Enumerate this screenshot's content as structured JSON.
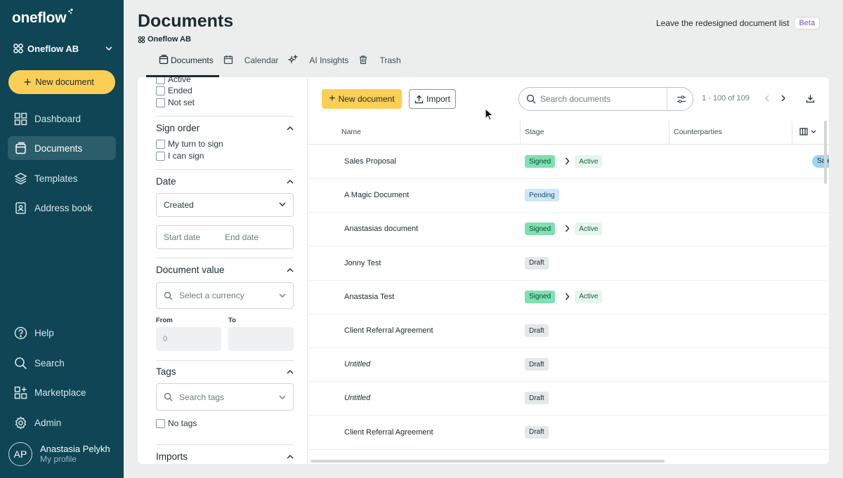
{
  "sidebar": {
    "logo": "oneflow",
    "workspace": "Oneflow AB",
    "new_document": "New document",
    "nav": [
      {
        "label": "Dashboard",
        "icon": "dashboard-icon"
      },
      {
        "label": "Documents",
        "icon": "documents-icon",
        "active": true
      },
      {
        "label": "Templates",
        "icon": "templates-icon"
      },
      {
        "label": "Address book",
        "icon": "address-book-icon"
      }
    ],
    "bottom_nav": [
      {
        "label": "Help",
        "icon": "help-icon"
      },
      {
        "label": "Search",
        "icon": "search-icon"
      },
      {
        "label": "Marketplace",
        "icon": "marketplace-icon"
      },
      {
        "label": "Admin",
        "icon": "gear-icon"
      }
    ],
    "profile": {
      "initials": "AP",
      "name": "Anastasia Pelykh",
      "subtitle": "My profile"
    }
  },
  "header": {
    "title": "Documents",
    "org": "Oneflow AB",
    "leave_redesign": "Leave the redesigned document list",
    "beta": "Beta",
    "tabs": [
      {
        "label": "Documents",
        "icon": "document-icon",
        "active": true
      },
      {
        "label": "Calendar",
        "icon": "calendar-icon"
      },
      {
        "label": "AI Insights",
        "icon": "sparkle-icon"
      },
      {
        "label": "Trash",
        "icon": "trash-icon"
      }
    ]
  },
  "filters": {
    "status_options": [
      "Active",
      "Ended",
      "Not set"
    ],
    "sign_order": {
      "title": "Sign order",
      "options": [
        "My turn to sign",
        "I can sign"
      ]
    },
    "date": {
      "title": "Date",
      "selected": "Created",
      "start_placeholder": "Start date",
      "end_placeholder": "End date"
    },
    "document_value": {
      "title": "Document value",
      "currency_placeholder": "Select a currency",
      "from_label": "From",
      "to_label": "To",
      "from_value": "0"
    },
    "tags": {
      "title": "Tags",
      "search_placeholder": "Search tags",
      "no_tags": "No tags"
    },
    "imports": {
      "title": "Imports"
    }
  },
  "toolbar": {
    "new_document": "New document",
    "import": "Import",
    "search_placeholder": "Search documents",
    "pagination": "1 - 100 of 109"
  },
  "table": {
    "columns": [
      "Name",
      "Stage",
      "Counterparties"
    ],
    "rows": [
      {
        "name": "Sales Proposal",
        "stages": [
          "Signed",
          "Active"
        ],
        "italic": false
      },
      {
        "name": "A Magic Document",
        "stages": [
          "Pending"
        ],
        "italic": false
      },
      {
        "name": "Anastasias document",
        "stages": [
          "Signed",
          "Active"
        ],
        "italic": false
      },
      {
        "name": "Jonny Test",
        "stages": [
          "Draft"
        ],
        "italic": false
      },
      {
        "name": "Anastasia Test",
        "stages": [
          "Signed",
          "Active"
        ],
        "italic": false
      },
      {
        "name": "Client Referral Agreement",
        "stages": [
          "Draft"
        ],
        "italic": false
      },
      {
        "name": "Untitled",
        "stages": [
          "Draft"
        ],
        "italic": true
      },
      {
        "name": "Untitled",
        "stages": [
          "Draft"
        ],
        "italic": true
      },
      {
        "name": "Client Referral Agreement",
        "stages": [
          "Draft"
        ],
        "italic": false
      }
    ],
    "tag_peek": "Sale"
  },
  "colors": {
    "sidebar": "#0f4555",
    "accent": "#fbcf55",
    "signed": "#7fe0b2",
    "pending": "#cfe7f7",
    "draft": "#e5e8e9"
  }
}
